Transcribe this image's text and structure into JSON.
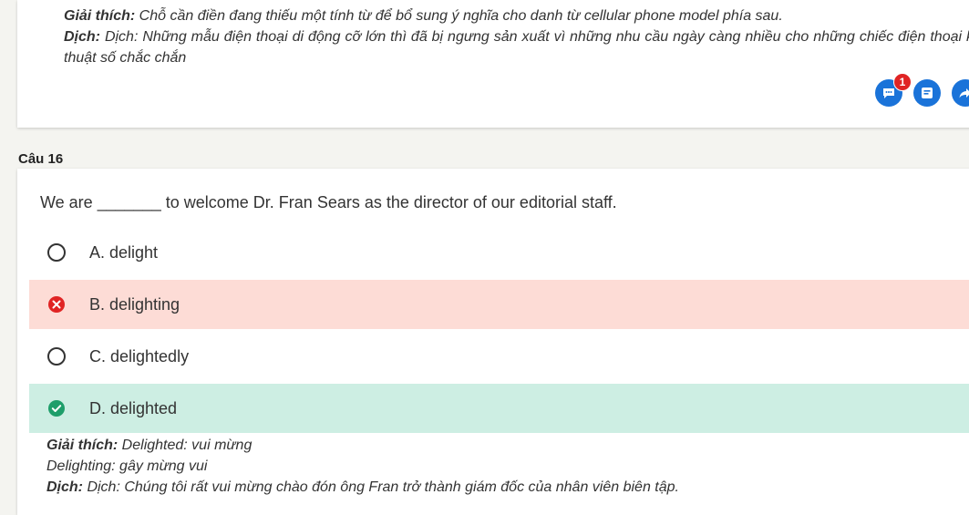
{
  "prev_explanation": {
    "giai_thich_label": "Giải thích:",
    "giai_thich_text": " Chỗ cần điền đang thiếu một tính từ để bổ sung ý nghĩa cho danh từ cellular phone model phía sau.",
    "dich_label": "Dịch:",
    "dich_text": " Dịch: Những mẫu điện thoại di động cỡ lớn thì đã bị ngưng sản xuất vì những nhu cầu ngày càng nhiều cho những chiếc điện thoại kỹ thuật số chắc chắn"
  },
  "actions": {
    "comment_badge": "1",
    "comment_icon": "chat-bubble-icon",
    "note_icon": "note-icon",
    "share_icon": "share-arrow-icon",
    "color": "#1a73d9"
  },
  "question": {
    "label": "Câu 16",
    "text": "We are _______ to welcome Dr. Fran Sears as the director of our editorial staff.",
    "options": [
      {
        "label": "A. delight",
        "state": "unselected"
      },
      {
        "label": "B. delighting",
        "state": "wrong"
      },
      {
        "label": "C. delightedly",
        "state": "unselected"
      },
      {
        "label": "D. delighted",
        "state": "correct"
      }
    ]
  },
  "explanation": {
    "giai_thich_label": "Giải thích:",
    "line1": " Delighted: vui mừng",
    "line2": "Delighting: gây mừng vui",
    "dich_label": "Dịch:",
    "dich_text": " Dịch: Chúng tôi rất vui mừng chào đón ông Fran trở thành giám đốc của nhân viên biên tập."
  },
  "colors": {
    "wrong_bg": "#fddcd6",
    "wrong_icon": "#e02424",
    "correct_bg": "#cdeee3",
    "correct_icon": "#1e9e6a"
  }
}
